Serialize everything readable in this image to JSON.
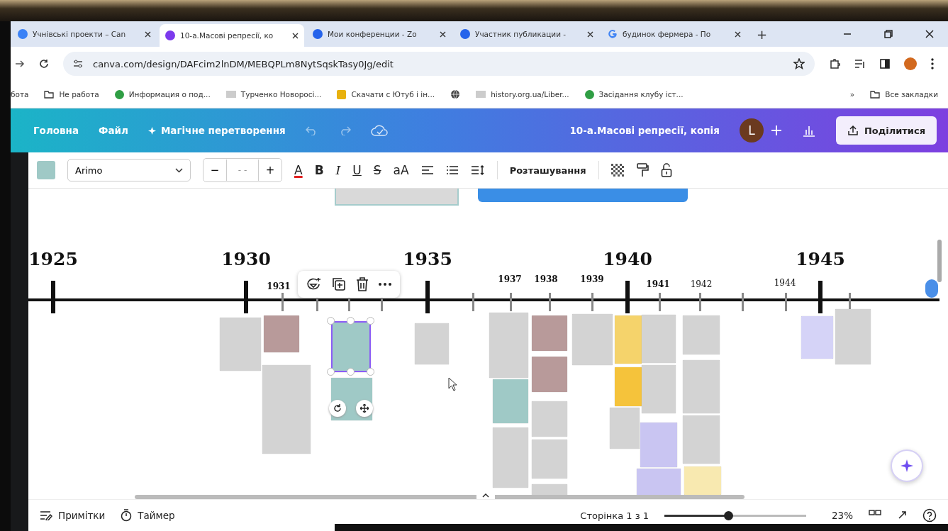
{
  "browser": {
    "tabs": [
      {
        "title": "Учнівські проекти – Can",
        "selected": false
      },
      {
        "title": "10-а.Масові репресії, ко",
        "selected": true
      },
      {
        "title": "Мои конференции - Zo",
        "selected": false
      },
      {
        "title": "Участник публикации -",
        "selected": false
      },
      {
        "title": "будинок фермера - По",
        "selected": false
      }
    ],
    "new_tab": "+",
    "address": "canva.com/design/DAFcim2lnDM/MEBQPLm8NytSqskTasy0Jg/edit",
    "bookmarks": [
      {
        "label": "бота",
        "kind": "text"
      },
      {
        "label": "Не работа",
        "kind": "folder"
      },
      {
        "label": "Информация о под...",
        "kind": "site"
      },
      {
        "label": "Турченко Новоросі...",
        "kind": "image"
      },
      {
        "label": "Скачати с Ютуб і ін...",
        "kind": "download"
      },
      {
        "kind": "globe"
      },
      {
        "label": "history.org.ua/Liber...",
        "kind": "image"
      },
      {
        "label": "Засідання клубу іст...",
        "kind": "site"
      }
    ],
    "more": "»",
    "all_bookmarks": "Все закладки"
  },
  "editor": {
    "menu": [
      "Головна",
      "Файл"
    ],
    "magic": "Магічне перетворення",
    "title": "10-а.Масові репресії, копія",
    "avatar": "L",
    "share": "Поділитися"
  },
  "toolbar": {
    "font": "Arimo",
    "size_minus": "−",
    "size": "- -",
    "size_plus": "+",
    "format": [
      {
        "label": "A",
        "kind": "color"
      },
      {
        "label": "B",
        "kind": "bold"
      },
      {
        "label": "I",
        "kind": "italic"
      },
      {
        "label": "U",
        "kind": "underline"
      },
      {
        "label": "S",
        "kind": "strike"
      },
      {
        "label": "aA",
        "kind": "case"
      }
    ],
    "position": "Розташування"
  },
  "timeline": {
    "years": [
      {
        "label": "1925",
        "kind": "major",
        "bold": true
      },
      {
        "label": "1930",
        "kind": "major",
        "bold": true
      },
      {
        "label": "1931",
        "kind": "minor",
        "bold": true
      },
      {
        "label": "1935",
        "kind": "major",
        "bold": true
      },
      {
        "label": "1937",
        "kind": "minor",
        "bold": true
      },
      {
        "label": "1938",
        "kind": "minor",
        "bold": true
      },
      {
        "label": "1939",
        "kind": "minor",
        "bold": true
      },
      {
        "label": "1940",
        "kind": "major",
        "bold": true
      },
      {
        "label": "1941",
        "kind": "minor",
        "bold": true
      },
      {
        "label": "1942",
        "kind": "minor",
        "bold": false
      },
      {
        "label": "1944",
        "kind": "minor",
        "bold": false
      },
      {
        "label": "1945",
        "kind": "major",
        "bold": true
      }
    ]
  },
  "footer": {
    "notes": "Примітки",
    "timer": "Таймер",
    "page": "Сторінка 1 з 1",
    "zoom": "23%",
    "zoom_slider": {
      "level": 0.45
    }
  }
}
